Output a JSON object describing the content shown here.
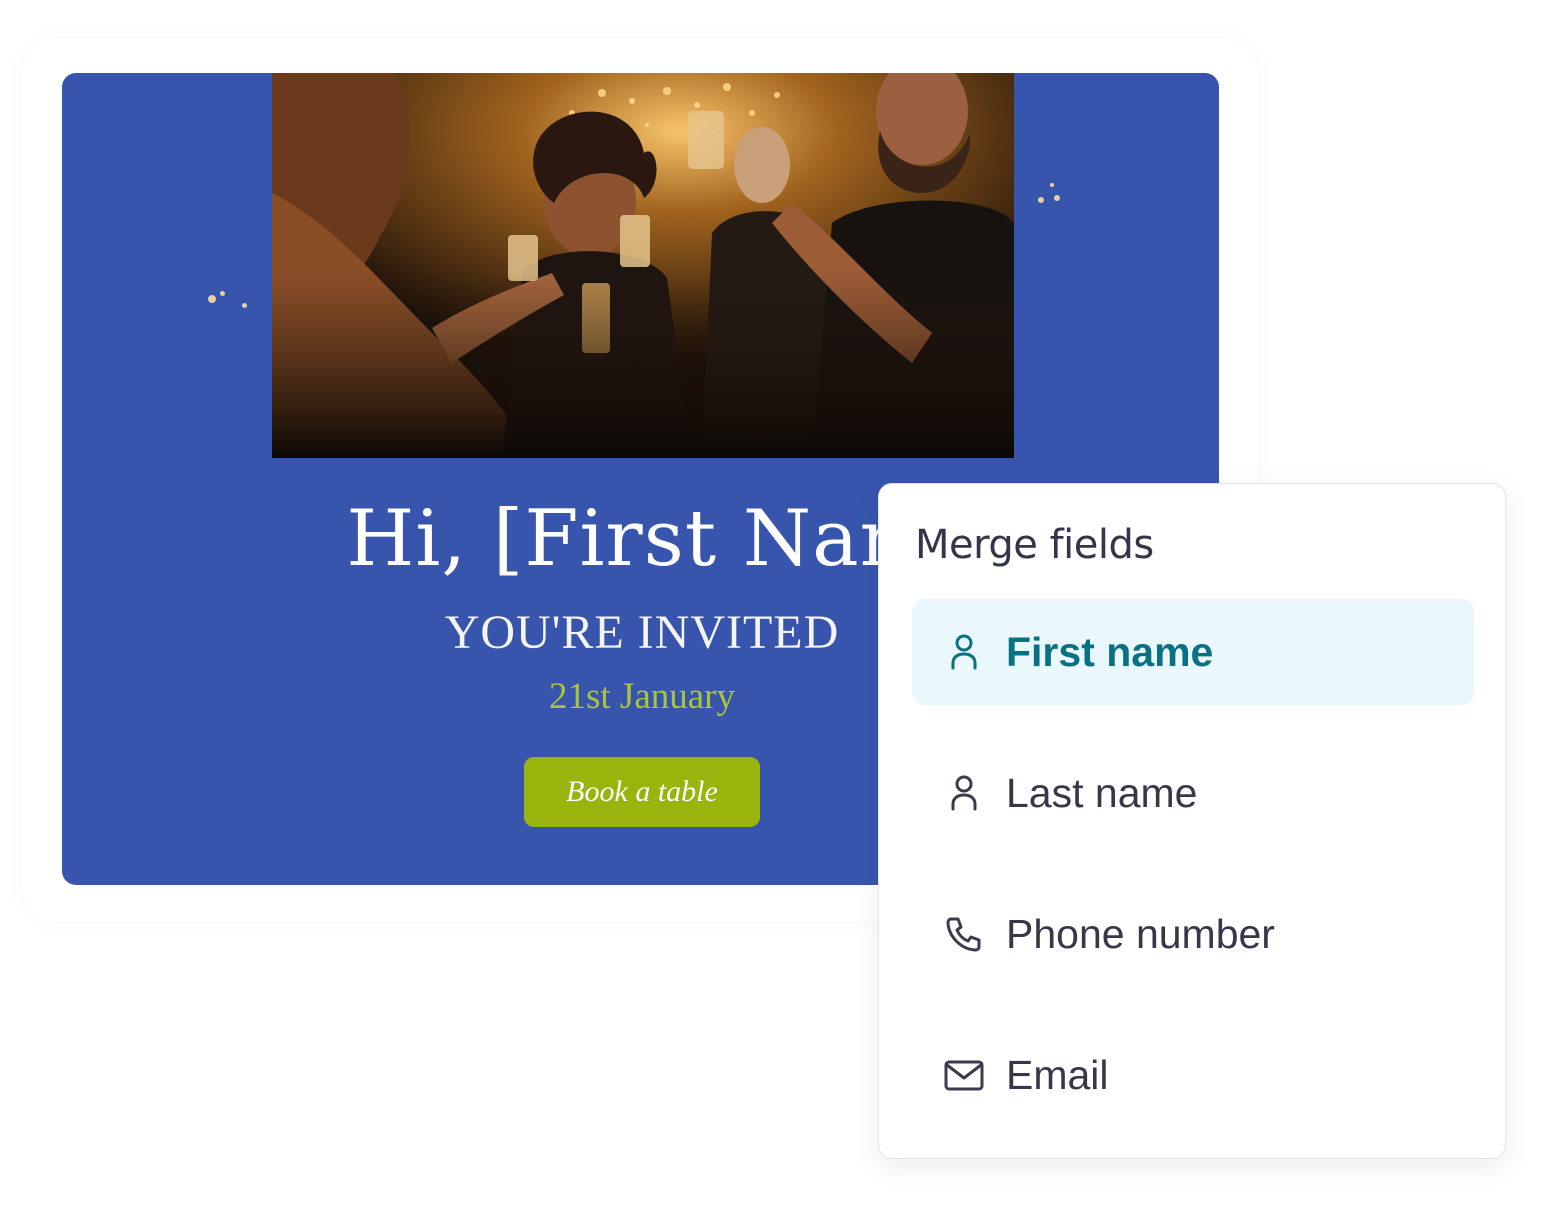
{
  "email_preview": {
    "greeting": "Hi, [First Nam",
    "headline": "YOU'RE INVITED",
    "date": "21st January",
    "cta_label": "Book a table",
    "background_color": "#3855ad",
    "accent_color": "#98b40d"
  },
  "merge_fields_panel": {
    "title": "Merge fields",
    "items": [
      {
        "label": "First name",
        "icon": "person-icon",
        "selected": true
      },
      {
        "label": "Last name",
        "icon": "person-icon",
        "selected": false
      },
      {
        "label": "Phone number",
        "icon": "phone-icon",
        "selected": false
      },
      {
        "label": "Email",
        "icon": "mail-icon",
        "selected": false
      }
    ],
    "selected_color": "#0a7184",
    "selected_bg": "#eaf7fc"
  }
}
